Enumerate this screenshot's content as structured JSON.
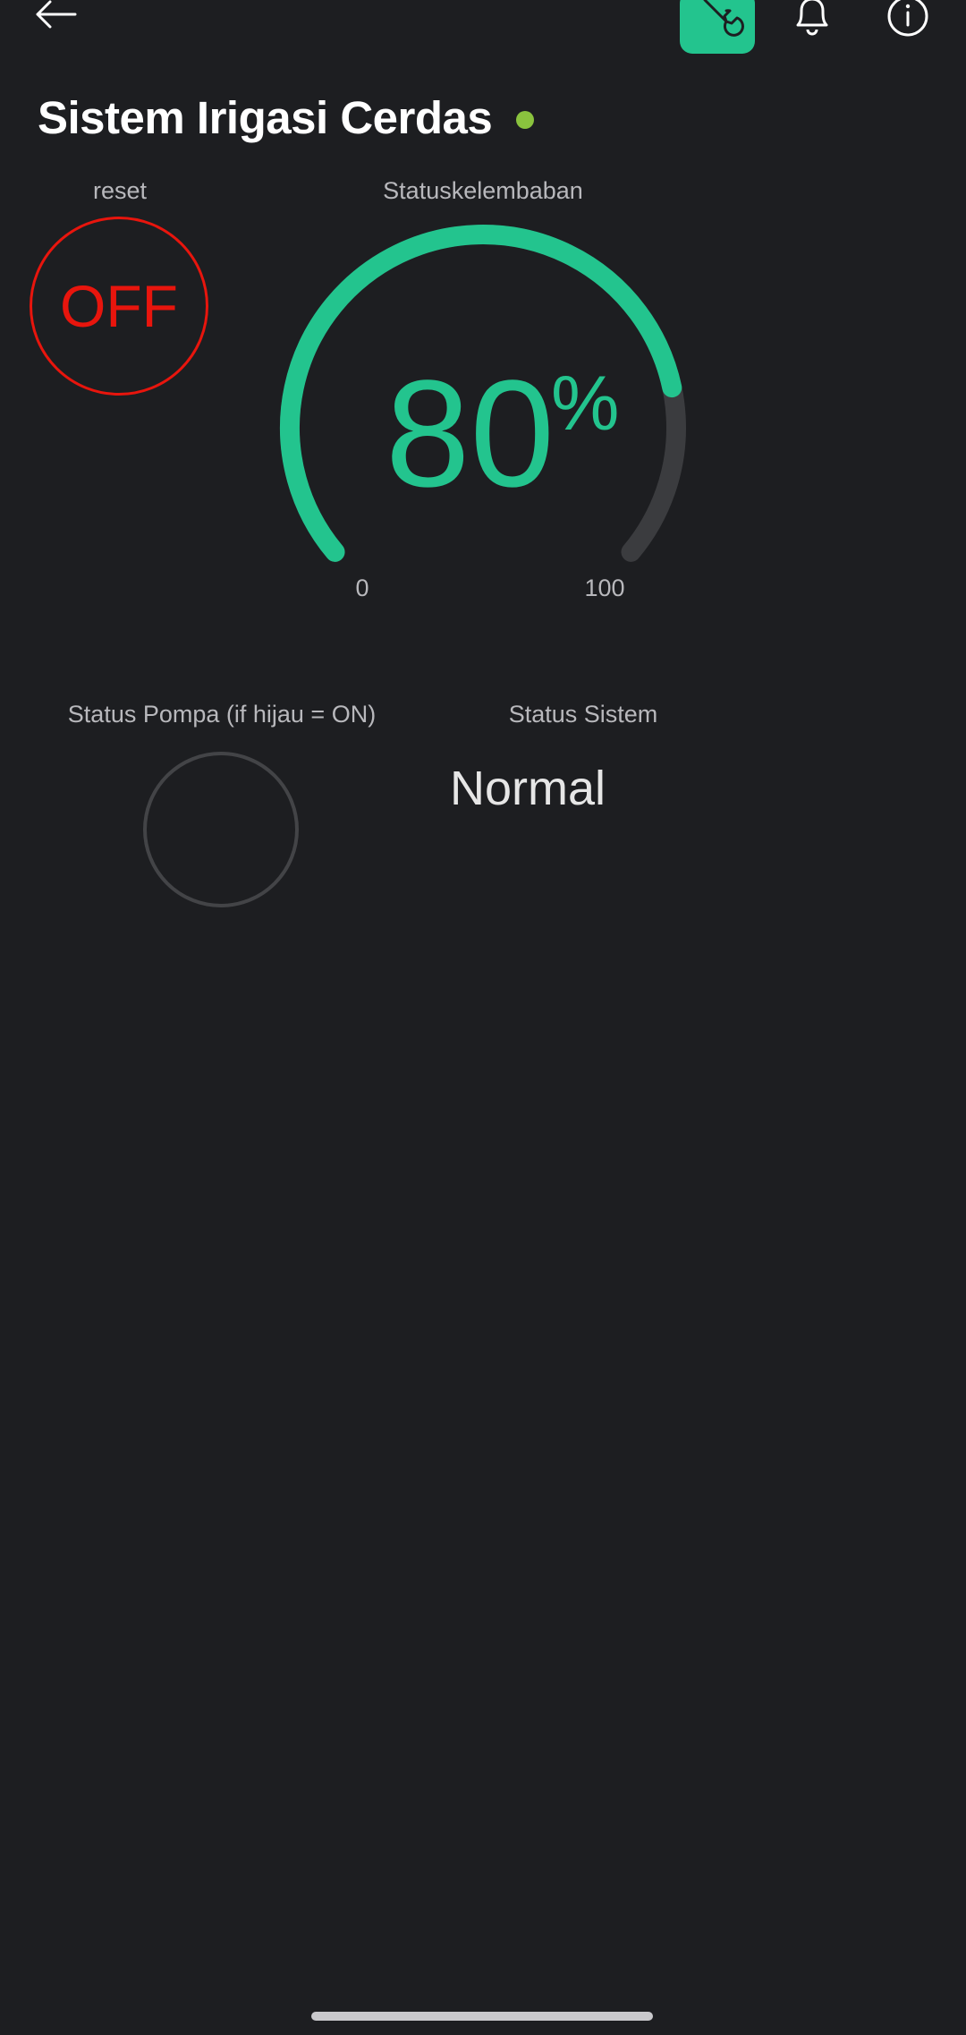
{
  "header": {
    "back_icon": "arrow-left-icon",
    "settings_icon": "wrench-icon",
    "notifications_icon": "bell-icon",
    "info_icon": "info-icon",
    "accent_color": "#23c48e"
  },
  "device": {
    "title": "Sistem Irigasi Cerdas",
    "online_color": "#8ac33e"
  },
  "reset": {
    "label": "reset",
    "value": "OFF",
    "color": "#e8150d"
  },
  "gauge": {
    "label": "Statuskelembaban",
    "value": "80",
    "unit": "%",
    "min": "0",
    "max": "100",
    "fraction": 0.8,
    "color": "#23c48e",
    "track_color": "#3b3c3f"
  },
  "pump": {
    "label": "Status Pompa (if hijau = ON)",
    "state": "off",
    "off_color": "#434447"
  },
  "system": {
    "label": "Status Sistem",
    "value": "Normal"
  }
}
